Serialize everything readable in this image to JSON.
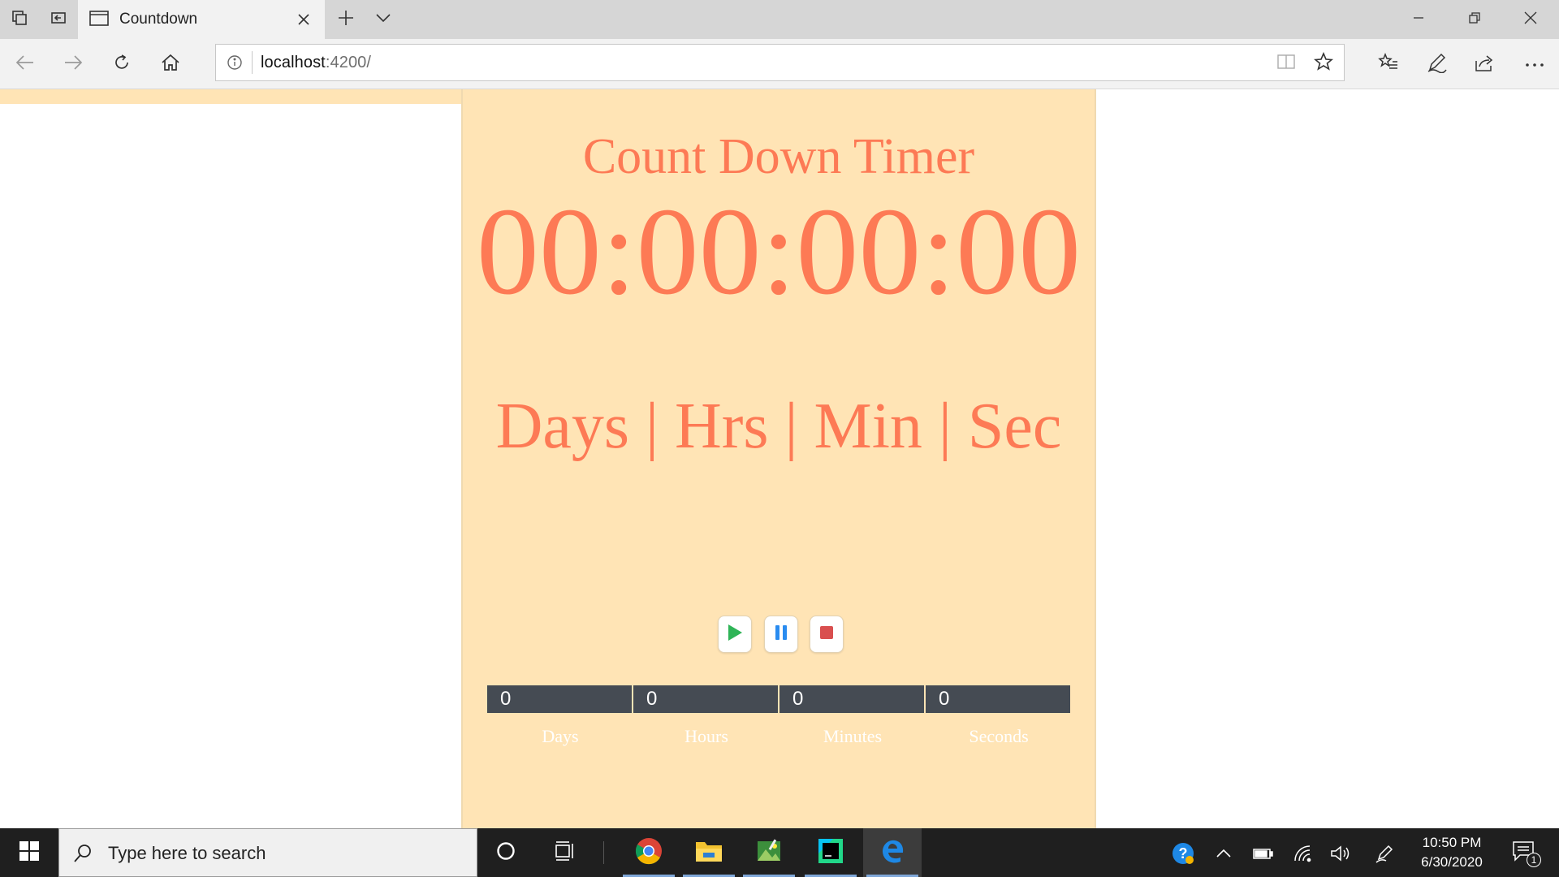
{
  "browser": {
    "tab": {
      "title": "Countdown"
    },
    "address": {
      "host": "localhost",
      "port": ":4200/"
    }
  },
  "page": {
    "title": "Count Down Timer",
    "timer_display": "00:00:00:00",
    "units_label": "Days | Hrs | Min | Sec",
    "inputs": [
      {
        "value": "0",
        "label": "Days"
      },
      {
        "value": "0",
        "label": "Hours"
      },
      {
        "value": "0",
        "label": "Minutes"
      },
      {
        "value": "0",
        "label": "Seconds"
      }
    ],
    "colors": {
      "panel_bg": "#ffe4b5",
      "accent": "#fd7a55",
      "input_bg": "#454b53",
      "play": "#2fb457",
      "pause": "#2a8cf0",
      "stop": "#d94f4f"
    }
  },
  "taskbar": {
    "search_placeholder": "Type here to search",
    "time": "10:50 PM",
    "date": "6/30/2020",
    "notification_count": "1"
  }
}
